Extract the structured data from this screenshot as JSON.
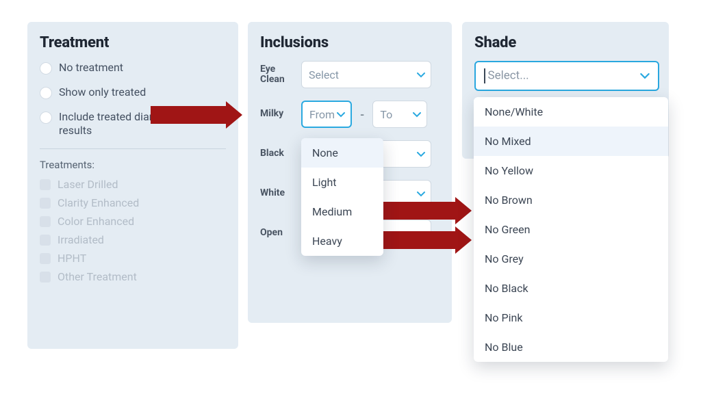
{
  "treatment": {
    "title": "Treatment",
    "radios": [
      {
        "label": "No treatment"
      },
      {
        "label": "Show only treated"
      },
      {
        "label": "Include treated diamonds in results"
      }
    ],
    "subhead": "Treatments:",
    "checks": [
      {
        "label": "Laser Drilled"
      },
      {
        "label": "Clarity Enhanced"
      },
      {
        "label": "Color Enhanced"
      },
      {
        "label": "Irradiated"
      },
      {
        "label": "HPHT"
      },
      {
        "label": "Other Treatment"
      }
    ]
  },
  "inclusions": {
    "title": "Inclusions",
    "rows": {
      "eye_clean": {
        "label": "Eye Clean",
        "value": "Select"
      },
      "milky": {
        "label": "Milky",
        "from": "From",
        "to": "To"
      },
      "black": {
        "label": "Black",
        "value": ""
      },
      "white": {
        "label": "White",
        "value": ""
      },
      "open": {
        "label": "Open",
        "value": ""
      }
    },
    "milky_options": [
      {
        "label": "None"
      },
      {
        "label": "Light"
      },
      {
        "label": "Medium"
      },
      {
        "label": "Heavy"
      }
    ]
  },
  "shade": {
    "title": "Shade",
    "placeholder": "Select...",
    "options": [
      {
        "label": "None/White"
      },
      {
        "label": "No Mixed"
      },
      {
        "label": "No Yellow"
      },
      {
        "label": "No Brown"
      },
      {
        "label": "No Green"
      },
      {
        "label": "No Grey"
      },
      {
        "label": "No Black"
      },
      {
        "label": "No Pink"
      },
      {
        "label": "No Blue"
      }
    ]
  },
  "colors": {
    "accent": "#29a7df",
    "arrow": "#a01515",
    "panel_bg": "#e4ecf3"
  },
  "dash": "-"
}
